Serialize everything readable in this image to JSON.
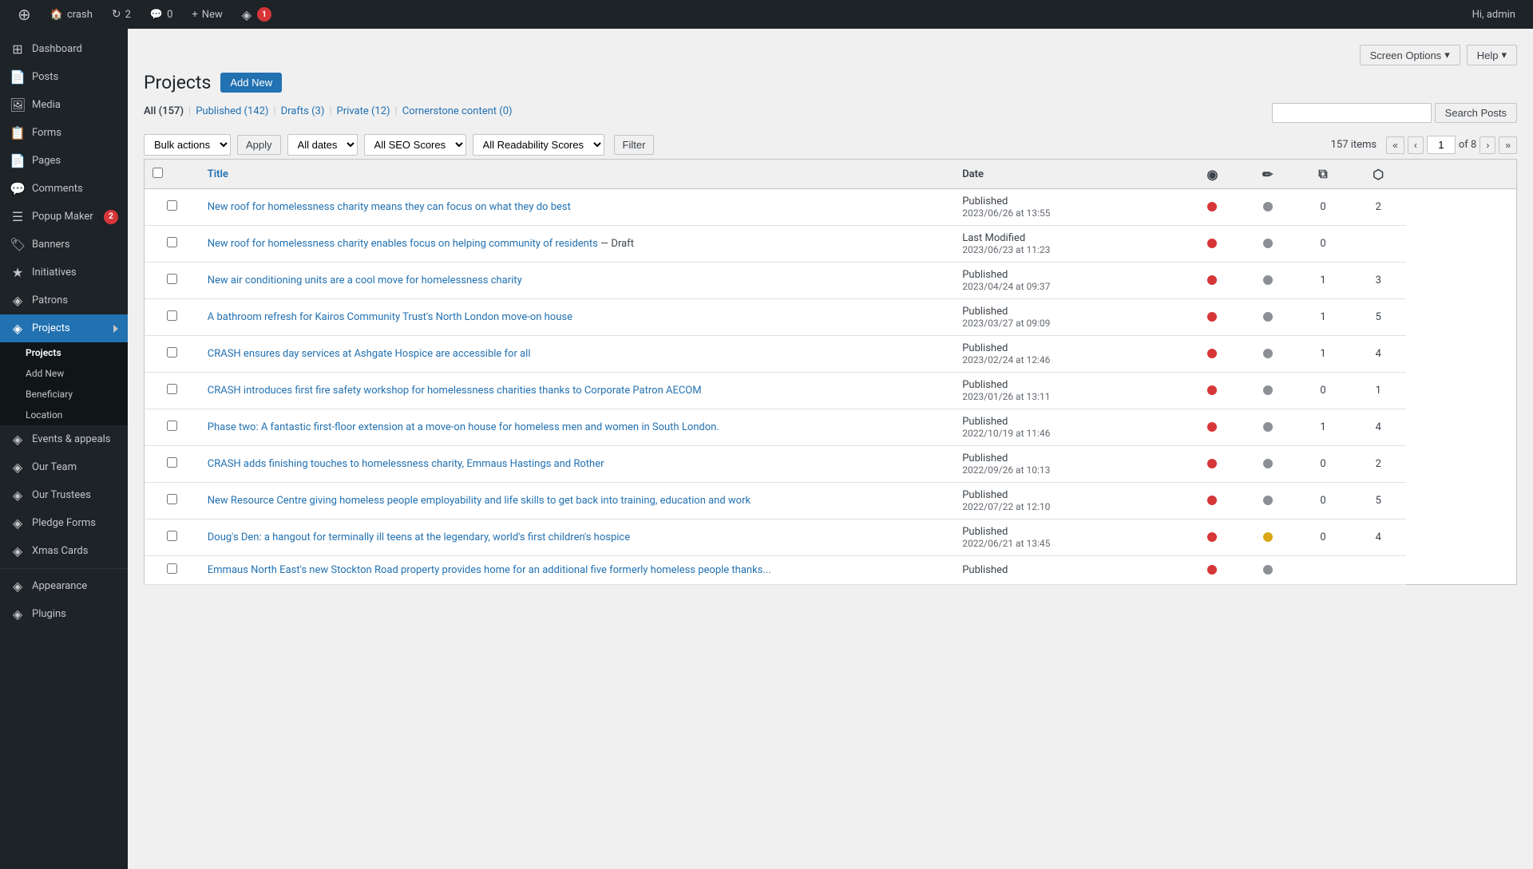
{
  "adminbar": {
    "site_name": "crash",
    "updates_count": "2",
    "comments_count": "0",
    "new_label": "New",
    "user_greeting": "Hi, admin",
    "wp_icon": "⊕"
  },
  "screen_meta": {
    "screen_options_label": "Screen Options",
    "help_label": "Help"
  },
  "sidebar": {
    "items": [
      {
        "id": "dashboard",
        "label": "Dashboard",
        "icon": "⊞"
      },
      {
        "id": "posts",
        "label": "Posts",
        "icon": "📄"
      },
      {
        "id": "media",
        "label": "Media",
        "icon": "🖼"
      },
      {
        "id": "forms",
        "label": "Forms",
        "icon": "📋"
      },
      {
        "id": "pages",
        "label": "Pages",
        "icon": "📄"
      },
      {
        "id": "comments",
        "label": "Comments",
        "icon": "💬"
      },
      {
        "id": "popup-maker",
        "label": "Popup Maker",
        "icon": "☰",
        "badge": "2"
      },
      {
        "id": "banners",
        "label": "Banners",
        "icon": "🏷"
      },
      {
        "id": "initiatives",
        "label": "Initiatives",
        "icon": "★"
      },
      {
        "id": "patrons",
        "label": "Patrons",
        "icon": "◈"
      },
      {
        "id": "projects",
        "label": "Projects",
        "icon": "◈",
        "active": true
      },
      {
        "id": "events-appeals",
        "label": "Events & appeals",
        "icon": "◈"
      },
      {
        "id": "our-team",
        "label": "Our Team",
        "icon": "◈"
      },
      {
        "id": "our-trustees",
        "label": "Our Trustees",
        "icon": "◈"
      },
      {
        "id": "pledge-forms",
        "label": "Pledge Forms",
        "icon": "◈"
      },
      {
        "id": "xmas-cards",
        "label": "Xmas Cards",
        "icon": "◈"
      },
      {
        "id": "appearance",
        "label": "Appearance",
        "icon": "◈"
      },
      {
        "id": "plugins",
        "label": "Plugins",
        "icon": "◈"
      }
    ],
    "submenu": {
      "parent": "Projects",
      "items": [
        {
          "id": "projects-list",
          "label": "Projects",
          "active": true
        },
        {
          "id": "add-new",
          "label": "Add New"
        },
        {
          "id": "beneficiary",
          "label": "Beneficiary"
        },
        {
          "id": "location",
          "label": "Location"
        }
      ]
    }
  },
  "page": {
    "title": "Projects",
    "add_new_label": "Add New"
  },
  "filter_tabs": {
    "all": {
      "label": "All",
      "count": "157",
      "active": true
    },
    "published": {
      "label": "Published",
      "count": "142"
    },
    "drafts": {
      "label": "Drafts",
      "count": "3"
    },
    "private": {
      "label": "Private",
      "count": "12"
    },
    "cornerstone": {
      "label": "Cornerstone content",
      "count": "0"
    }
  },
  "search": {
    "placeholder": "",
    "button_label": "Search Posts"
  },
  "toolbar": {
    "bulk_actions_label": "Bulk actions",
    "apply_label": "Apply",
    "all_dates_label": "All dates",
    "seo_scores_label": "All SEO Scores",
    "readability_label": "All Readability Scores",
    "filter_label": "Filter",
    "items_count": "157 items",
    "page_current": "1",
    "page_total": "8"
  },
  "table": {
    "columns": {
      "title": "Title",
      "date": "Date"
    },
    "rows": [
      {
        "id": 1,
        "title": "New roof for homelessness charity means they can focus on what they do best",
        "draft": false,
        "date_label": "Published",
        "date": "2023/06/26 at 13:55",
        "seo_dot": "red",
        "read_dot": "gray",
        "num1": "0",
        "num2": "2"
      },
      {
        "id": 2,
        "title": "New roof for homelessness charity enables focus on helping community of residents",
        "draft": true,
        "draft_label": "— Draft",
        "date_label": "Last Modified",
        "date": "2023/06/23 at 11:23",
        "seo_dot": "red",
        "read_dot": "gray",
        "num1": "0",
        "num2": ""
      },
      {
        "id": 3,
        "title": "New air conditioning units are a cool move for homelessness charity",
        "draft": false,
        "date_label": "Published",
        "date": "2023/04/24 at 09:37",
        "seo_dot": "red",
        "read_dot": "gray",
        "num1": "1",
        "num2": "3"
      },
      {
        "id": 4,
        "title": "A bathroom refresh for Kairos Community Trust's North London move-on house",
        "draft": false,
        "date_label": "Published",
        "date": "2023/03/27 at 09:09",
        "seo_dot": "red",
        "read_dot": "gray",
        "num1": "1",
        "num2": "5"
      },
      {
        "id": 5,
        "title": "CRASH ensures day services at Ashgate Hospice are accessible for all",
        "draft": false,
        "date_label": "Published",
        "date": "2023/02/24 at 12:46",
        "seo_dot": "red",
        "read_dot": "gray",
        "num1": "1",
        "num2": "4"
      },
      {
        "id": 6,
        "title": "CRASH introduces first fire safety workshop for homelessness charities thanks to Corporate Patron AECOM",
        "draft": false,
        "date_label": "Published",
        "date": "2023/01/26 at 13:11",
        "seo_dot": "red",
        "read_dot": "gray",
        "num1": "0",
        "num2": "1"
      },
      {
        "id": 7,
        "title": "Phase two: A fantastic first-floor extension at a move-on house for homeless men and women in South London.",
        "draft": false,
        "date_label": "Published",
        "date": "2022/10/19 at 11:46",
        "seo_dot": "red",
        "read_dot": "gray",
        "num1": "1",
        "num2": "4"
      },
      {
        "id": 8,
        "title": "CRASH adds finishing touches to homelessness charity, Emmaus Hastings and Rother",
        "draft": false,
        "date_label": "Published",
        "date": "2022/09/26 at 10:13",
        "seo_dot": "red",
        "read_dot": "gray",
        "num1": "0",
        "num2": "2"
      },
      {
        "id": 9,
        "title": "New Resource Centre giving homeless people employability and life skills to get back into training, education and work",
        "draft": false,
        "date_label": "Published",
        "date": "2022/07/22 at 12:10",
        "seo_dot": "red",
        "read_dot": "gray",
        "num1": "0",
        "num2": "5"
      },
      {
        "id": 10,
        "title": "Doug's Den: a hangout for terminally ill teens at the legendary, world's first children's hospice",
        "draft": false,
        "date_label": "Published",
        "date": "2022/06/21 at 13:45",
        "seo_dot": "red",
        "read_dot": "orange",
        "num1": "0",
        "num2": "4"
      },
      {
        "id": 11,
        "title": "Emmaus North East's new Stockton Road property provides home for an additional five formerly homeless people thanks...",
        "draft": false,
        "date_label": "Published",
        "date": "",
        "seo_dot": "red",
        "read_dot": "gray",
        "num1": "",
        "num2": ""
      }
    ]
  }
}
